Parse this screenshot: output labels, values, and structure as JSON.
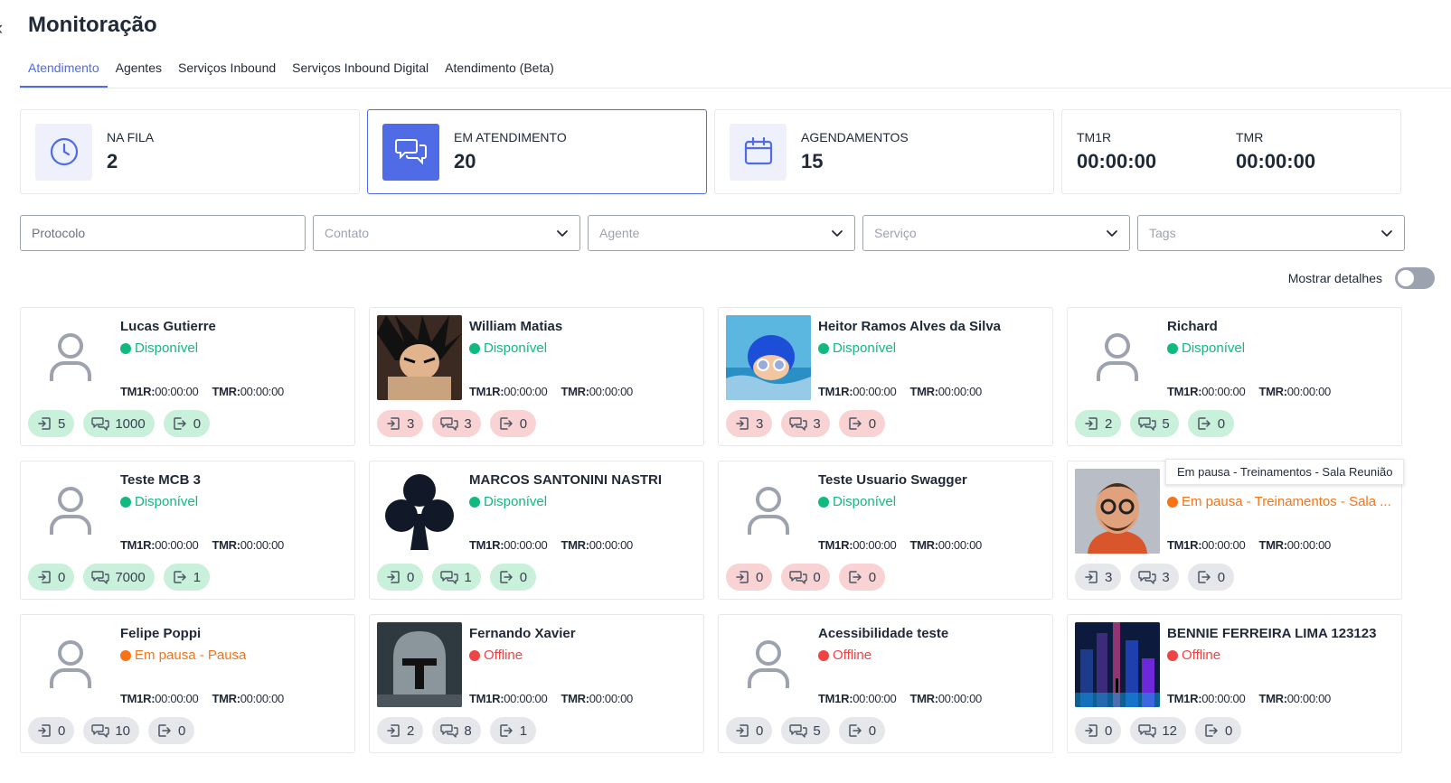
{
  "page": {
    "title": "Monitoração"
  },
  "tabs": [
    "Atendimento",
    "Agentes",
    "Serviços Inbound",
    "Serviços Inbound Digital",
    "Atendimento (Beta)"
  ],
  "stats": {
    "queue": {
      "label": "NA FILA",
      "value": "2"
    },
    "in_service": {
      "label": "EM ATENDIMENTO",
      "value": "20"
    },
    "schedules": {
      "label": "AGENDAMENTOS",
      "value": "15"
    },
    "tm1r": {
      "label": "TM1R",
      "value": "00:00:00"
    },
    "tmr": {
      "label": "TMR",
      "value": "00:00:00"
    }
  },
  "filters": {
    "protocolo": "Protocolo",
    "contato": "Contato",
    "agente": "Agente",
    "servico": "Serviço",
    "tags": "Tags"
  },
  "details_toggle": {
    "label": "Mostrar detalhes",
    "on": false
  },
  "tooltip": "Em pausa - Treinamentos - Sala Reunião",
  "colors": {
    "accent": "#4f6be5",
    "available": "#10b981",
    "paused": "#f97316",
    "offline": "#ef4444"
  },
  "agents": [
    {
      "name": "Lucas Gutierre",
      "status": "Disponível",
      "tm1r_label": "TM1R:",
      "tm1r": "00:00:00",
      "tmr_label": "TMR:",
      "tmr": "00:00:00",
      "counts": [
        "5",
        "1000",
        "0"
      ]
    },
    {
      "name": "William Matias",
      "status": "Disponível",
      "tm1r_label": "TM1R:",
      "tm1r": "00:00:00",
      "tmr_label": "TMR:",
      "tmr": "00:00:00",
      "counts": [
        "3",
        "3",
        "0"
      ]
    },
    {
      "name": "Heitor Ramos Alves da Silva",
      "status": "Disponível",
      "tm1r_label": "TM1R:",
      "tm1r": "00:00:00",
      "tmr_label": "TMR:",
      "tmr": "00:00:00",
      "counts": [
        "3",
        "3",
        "0"
      ]
    },
    {
      "name": "Richard",
      "status": "Disponível",
      "tm1r_label": "TM1R:",
      "tm1r": "00:00:00",
      "tmr_label": "TMR:",
      "tmr": "00:00:00",
      "counts": [
        "2",
        "5",
        "0"
      ]
    },
    {
      "name": "Teste MCB 3",
      "status": "Disponível",
      "tm1r_label": "TM1R:",
      "tm1r": "00:00:00",
      "tmr_label": "TMR:",
      "tmr": "00:00:00",
      "counts": [
        "0",
        "7000",
        "1"
      ]
    },
    {
      "name": "MARCOS SANTONINI NASTRI",
      "status": "Disponível",
      "tm1r_label": "TM1R:",
      "tm1r": "00:00:00",
      "tmr_label": "TMR:",
      "tmr": "00:00:00",
      "counts": [
        "0",
        "1",
        "0"
      ]
    },
    {
      "name": "Teste Usuario Swagger",
      "status": "Disponível",
      "tm1r_label": "TM1R:",
      "tm1r": "00:00:00",
      "tmr_label": "TMR:",
      "tmr": "00:00:00",
      "counts": [
        "0",
        "0",
        "0"
      ]
    },
    {
      "name": "",
      "status": "Em pausa - Treinamentos - Sala ...",
      "tm1r_label": "TM1R:",
      "tm1r": "00:00:00",
      "tmr_label": "TMR:",
      "tmr": "00:00:00",
      "counts": [
        "3",
        "3",
        "0"
      ]
    },
    {
      "name": "Felipe Poppi",
      "status": "Em pausa - Pausa",
      "tm1r_label": "TM1R:",
      "tm1r": "00:00:00",
      "tmr_label": "TMR:",
      "tmr": "00:00:00",
      "counts": [
        "0",
        "10",
        "0"
      ]
    },
    {
      "name": "Fernando Xavier",
      "status": "Offline",
      "tm1r_label": "TM1R:",
      "tm1r": "00:00:00",
      "tmr_label": "TMR:",
      "tmr": "00:00:00",
      "counts": [
        "2",
        "8",
        "1"
      ]
    },
    {
      "name": "Acessibilidade teste",
      "status": "Offline",
      "tm1r_label": "TM1R:",
      "tm1r": "00:00:00",
      "tmr_label": "TMR:",
      "tmr": "00:00:00",
      "counts": [
        "0",
        "5",
        "0"
      ]
    },
    {
      "name": "BENNIE FERREIRA LIMA 123123",
      "status": "Offline",
      "tm1r_label": "TM1R:",
      "tm1r": "00:00:00",
      "tmr_label": "TMR:",
      "tmr": "00:00:00",
      "counts": [
        "0",
        "12",
        "0"
      ]
    }
  ]
}
